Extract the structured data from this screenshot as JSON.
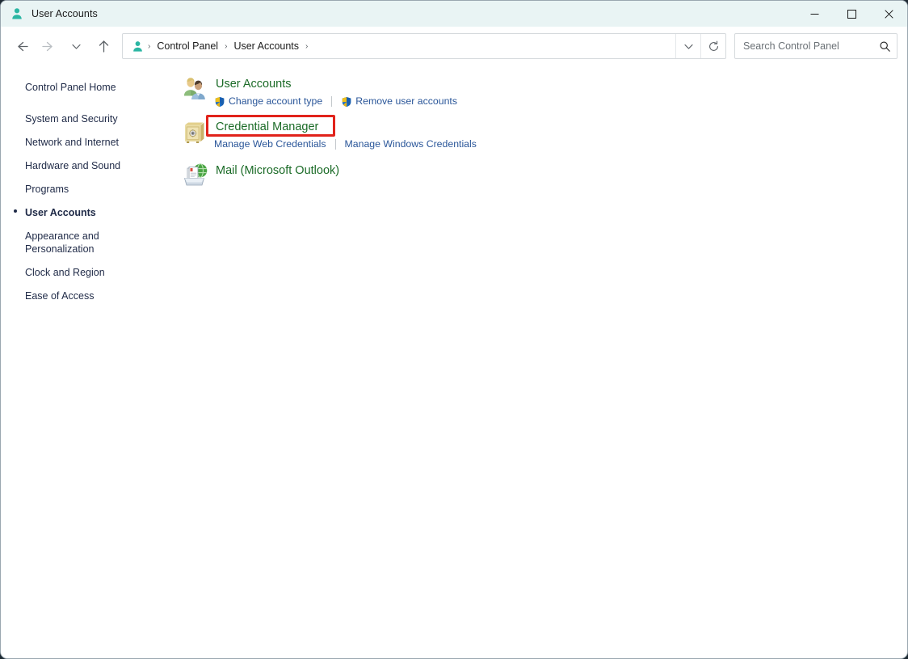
{
  "window": {
    "title": "User Accounts",
    "icon": "user-account-icon",
    "minimize_label": "Minimize",
    "maximize_label": "Maximize",
    "close_label": "Close"
  },
  "navbar": {
    "back_label": "Back",
    "forward_label": "Forward",
    "recent_label": "Recent locations",
    "up_label": "Up one level",
    "refresh_label": "Refresh",
    "history_label": "Previous locations",
    "breadcrumb": [
      {
        "label": "Control Panel"
      },
      {
        "label": "User Accounts"
      }
    ],
    "breadcrumb_separator": "›"
  },
  "search": {
    "placeholder": "Search Control Panel",
    "value": "",
    "icon": "search-icon"
  },
  "sidebar": {
    "home": {
      "label": "Control Panel Home"
    },
    "items": [
      {
        "label": "System and Security",
        "current": false
      },
      {
        "label": "Network and Internet",
        "current": false
      },
      {
        "label": "Hardware and Sound",
        "current": false
      },
      {
        "label": "Programs",
        "current": false
      },
      {
        "label": "User Accounts",
        "current": true
      },
      {
        "label": "Appearance and Personalization",
        "current": false
      },
      {
        "label": "Clock and Region",
        "current": false
      },
      {
        "label": "Ease of Access",
        "current": false
      }
    ]
  },
  "main": {
    "categories": [
      {
        "title": "User Accounts",
        "icon": "users-icon",
        "links": [
          {
            "label": "Change account type",
            "shield": true
          },
          {
            "label": "Remove user accounts",
            "shield": true
          }
        ]
      },
      {
        "title": "Credential Manager",
        "icon": "vault-icon",
        "highlighted": true,
        "links": [
          {
            "label": "Manage Web Credentials",
            "shield": false
          },
          {
            "label": "Manage Windows Credentials",
            "shield": false
          }
        ]
      },
      {
        "title": "Mail (Microsoft Outlook)",
        "icon": "mail-icon",
        "links": []
      }
    ]
  },
  "colors": {
    "titlebar_bg": "#e9f4f4",
    "category_title": "#1b6b27",
    "link": "#2a5699",
    "sidebar_text": "#1f2a47",
    "highlight": "#e1231b",
    "accent_teal": "#2bb6a3"
  }
}
